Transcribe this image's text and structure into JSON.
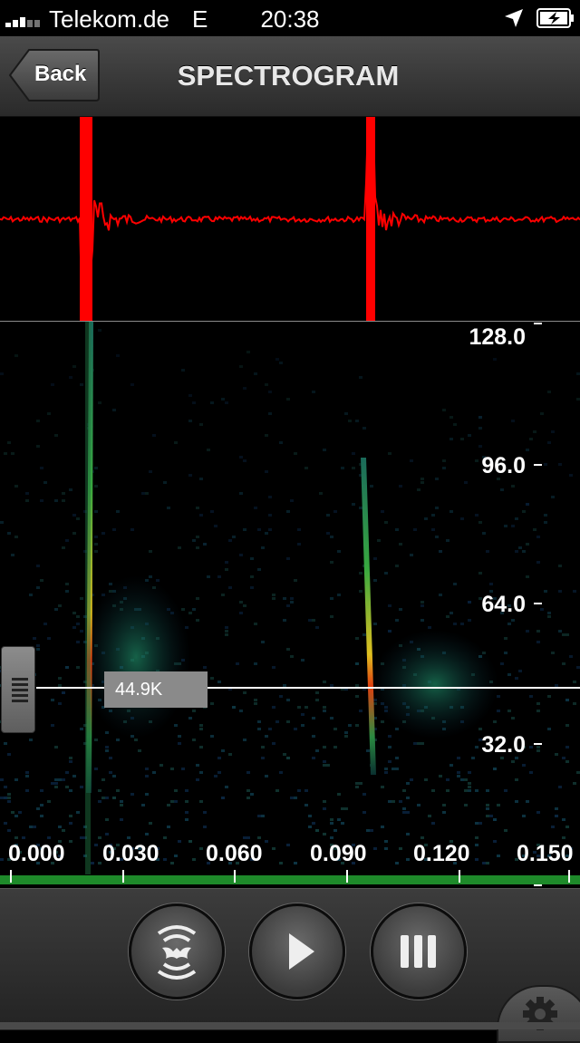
{
  "status_bar": {
    "carrier": "Telekom.de",
    "network": "E",
    "time": "20:38",
    "icons": [
      "signal-icon",
      "location-icon",
      "battery-charging-icon"
    ]
  },
  "nav": {
    "back_label": "Back",
    "title": "SPECTROGRAM"
  },
  "spectrogram": {
    "y_axis_labels": [
      "128.0",
      "96.0",
      "64.0",
      "32.0"
    ],
    "x_axis_labels": [
      "0.000",
      "0.030",
      "0.060",
      "0.090",
      "0.120",
      "0.150"
    ],
    "cursor_readout": "44.9K"
  },
  "toolbar": {
    "buttons": [
      "bat-icon",
      "play-icon",
      "pause-icon"
    ],
    "settings_icon": "gear-icon"
  },
  "colors": {
    "waveform": "#ff0000",
    "timeline": "#1e8a2a",
    "background": "#000000"
  }
}
